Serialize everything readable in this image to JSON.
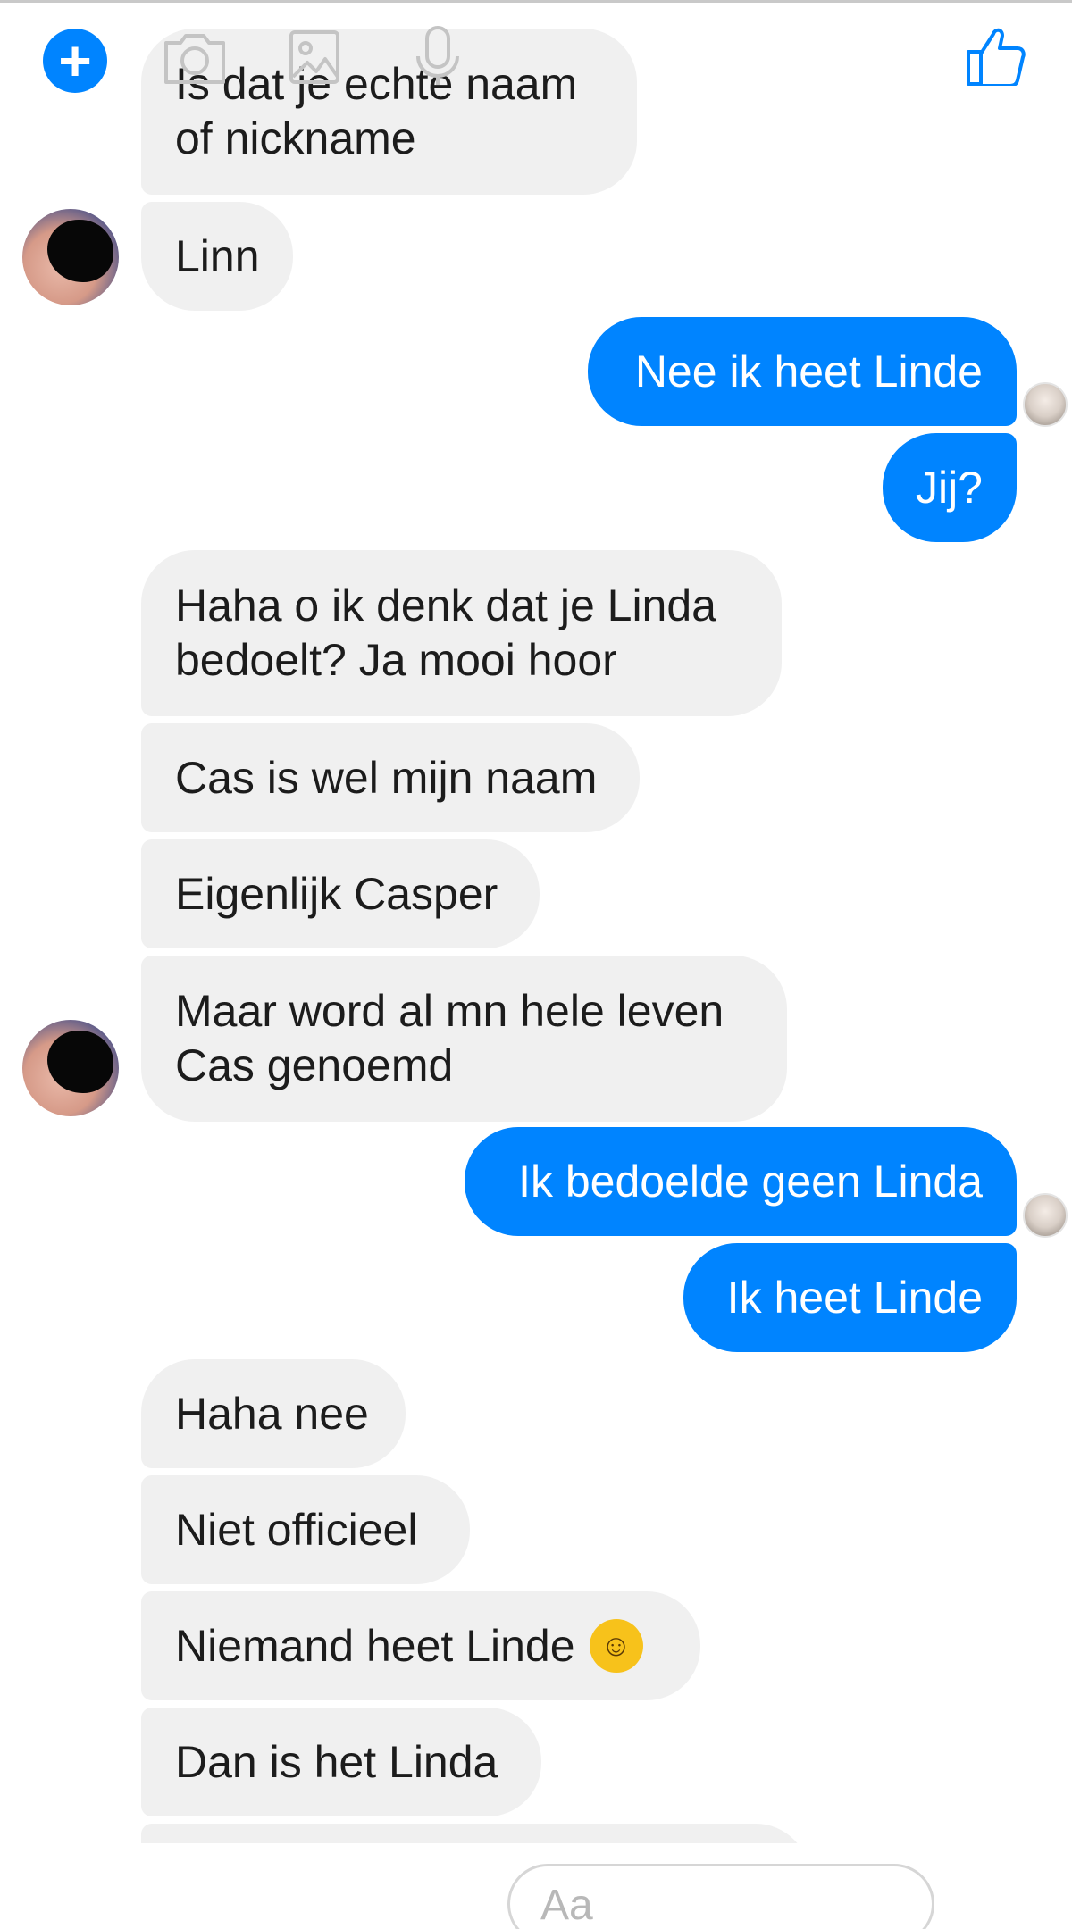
{
  "messages": [
    {
      "from": "them",
      "text": "Is dat je echte naam of nickname"
    },
    {
      "from": "them",
      "text": "Linn"
    },
    {
      "from": "me",
      "text": "Nee ik heet Linde"
    },
    {
      "from": "me",
      "text": "Jij?"
    },
    {
      "from": "them",
      "text": "Haha o ik denk dat je Linda bedoelt? Ja mooi hoor"
    },
    {
      "from": "them",
      "text": "Cas is wel mijn naam"
    },
    {
      "from": "them",
      "text": "Eigenlijk Casper"
    },
    {
      "from": "them",
      "text": "Maar word al mn hele leven Cas genoemd"
    },
    {
      "from": "me",
      "text": "Ik bedoelde geen Linda"
    },
    {
      "from": "me",
      "text": "Ik heet Linde"
    },
    {
      "from": "them",
      "text": "Haha nee"
    },
    {
      "from": "them",
      "text": "Niet officieel"
    },
    {
      "from": "them",
      "text": "Niemand heet Linde",
      "emoji": "face-with-tears-of-joy"
    },
    {
      "from": "them",
      "text": "Dan is het Linda"
    }
  ],
  "composer": {
    "placeholder": "Aa",
    "icons": [
      "plus-icon",
      "camera-icon",
      "image-icon",
      "microphone-icon",
      "thumbs-up-icon"
    ]
  },
  "colors": {
    "accent": "#0084ff",
    "incoming_bubble": "#f0f0f0",
    "incoming_text": "#1c1c1c",
    "outgoing_text": "#ffffff"
  }
}
